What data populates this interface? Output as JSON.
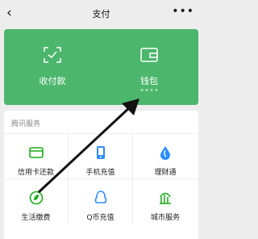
{
  "nav": {
    "back_icon": "chevron-left-icon",
    "title": "支付",
    "more_icon": "more-icon"
  },
  "panel": {
    "color": "#4cb66c",
    "buttons": [
      {
        "label": "收付款",
        "icon": "scan-qr-icon"
      },
      {
        "label": "钱包",
        "icon": "wallet-icon"
      }
    ]
  },
  "services": {
    "section_title": "腾讯服务",
    "items": [
      {
        "label": "信用卡还款",
        "icon": "credit-card-icon",
        "color": "#1aad19"
      },
      {
        "label": "手机充值",
        "icon": "phone-icon",
        "color": "#2a8cff"
      },
      {
        "label": "理财通",
        "icon": "water-drop-icon",
        "color": "#2a8cff"
      },
      {
        "label": "生活缴费",
        "icon": "leaf-icon",
        "color": "#1aad19"
      },
      {
        "label": "Q币充值",
        "icon": "penguin-icon",
        "color": "#2a8cff"
      },
      {
        "label": "城市服务",
        "icon": "city-icon",
        "color": "#1aad19"
      }
    ]
  },
  "annotation": {
    "color": "#111111",
    "icon": "arrow-icon"
  }
}
